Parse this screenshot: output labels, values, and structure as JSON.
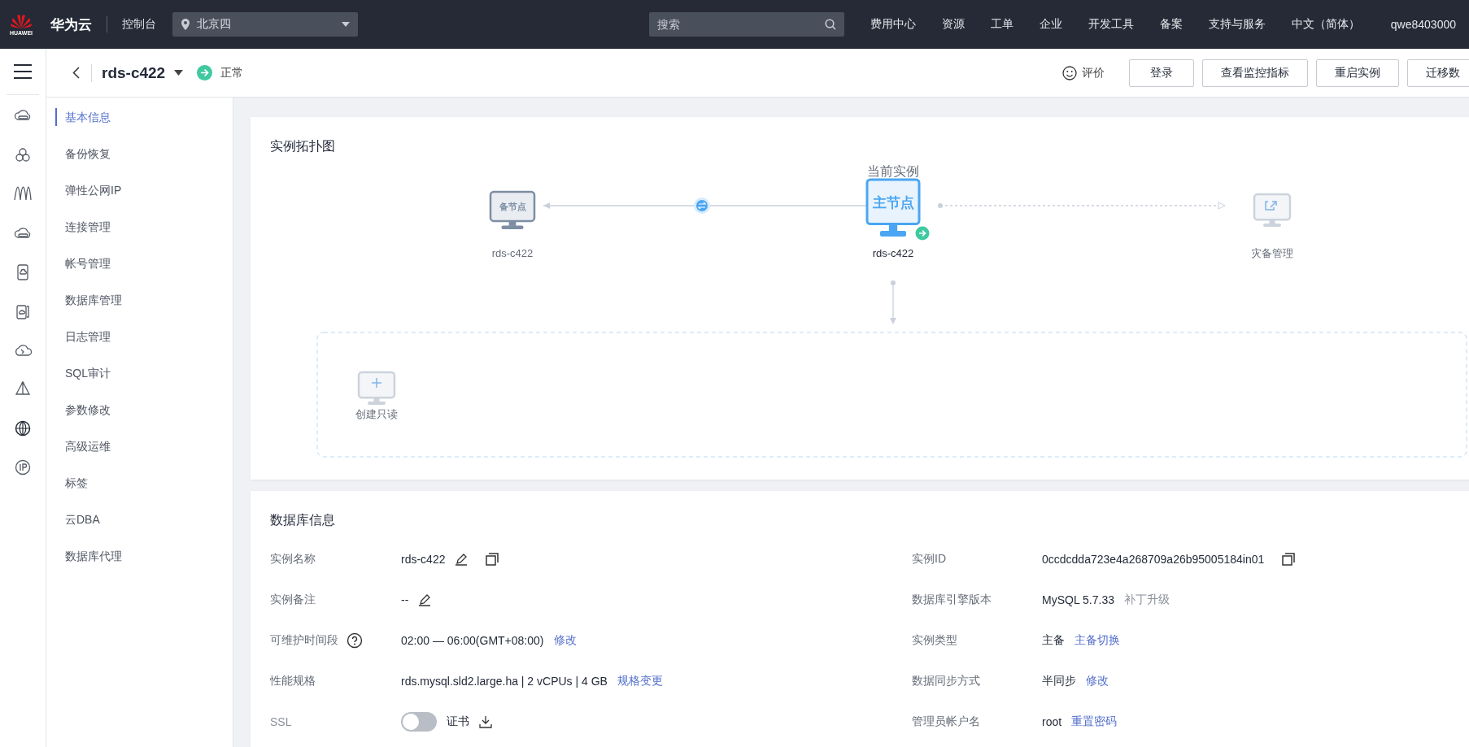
{
  "topbar": {
    "logo_text": "HUAWEI",
    "brand": "华为云",
    "console": "控制台",
    "region": "北京四",
    "search": {
      "placeholder": "搜索"
    },
    "nav": [
      "费用中心",
      "资源",
      "工单",
      "企业",
      "开发工具",
      "备案",
      "支持与服务",
      "中文（简体）"
    ],
    "user": "qwe8403000"
  },
  "header": {
    "title": "rds-c422",
    "status": "正常",
    "feedback": "评价",
    "buttons": [
      "登录",
      "查看监控指标",
      "重启实例",
      "迁移数"
    ]
  },
  "sidebar": {
    "items": [
      {
        "label": "基本信息",
        "selected": true
      },
      {
        "label": "备份恢复",
        "selected": false
      },
      {
        "label": "弹性公网IP",
        "selected": false
      },
      {
        "label": "连接管理",
        "selected": false
      },
      {
        "label": "帐号管理",
        "selected": false
      },
      {
        "label": "数据库管理",
        "selected": false
      },
      {
        "label": "日志管理",
        "selected": false
      },
      {
        "label": "SQL审计",
        "selected": false
      },
      {
        "label": "参数修改",
        "selected": false
      },
      {
        "label": "高级运维",
        "selected": false
      },
      {
        "label": "标签",
        "selected": false
      },
      {
        "label": "云DBA",
        "selected": false
      },
      {
        "label": "数据库代理",
        "selected": false
      }
    ]
  },
  "topology": {
    "title": "实例拓扑图",
    "current_label": "当前实例",
    "standby": {
      "badge": "备节点",
      "label": "rds-c422"
    },
    "primary": {
      "badge": "主节点",
      "label": "rds-c422"
    },
    "disaster": {
      "label": "灾备管理"
    },
    "readonly": {
      "label": "创建只读"
    }
  },
  "info": {
    "title": "数据库信息",
    "fields": [
      {
        "label": "实例名称",
        "parts": [
          {
            "kind": "text",
            "text": "rds-c422"
          },
          {
            "kind": "edit"
          },
          {
            "kind": "copy"
          }
        ]
      },
      {
        "label": "实例ID",
        "parts": [
          {
            "kind": "text",
            "text": "0ccdcdda723e4a268709a26b95005184in01"
          },
          {
            "kind": "copy"
          }
        ]
      },
      {
        "label": "实例备注",
        "parts": [
          {
            "kind": "text",
            "text": "--"
          },
          {
            "kind": "edit"
          }
        ]
      },
      {
        "label": "数据库引擎版本",
        "parts": [
          {
            "kind": "text",
            "text": "MySQL 5.7.33"
          },
          {
            "kind": "muted",
            "text": "补丁升级"
          }
        ]
      },
      {
        "label": "可维护时间段",
        "help": true,
        "parts": [
          {
            "kind": "text",
            "text": "02:00 — 06:00(GMT+08:00)"
          },
          {
            "kind": "link",
            "text": "修改"
          }
        ]
      },
      {
        "label": "实例类型",
        "parts": [
          {
            "kind": "text",
            "text": "主备"
          },
          {
            "kind": "link",
            "text": "主备切换"
          }
        ]
      },
      {
        "label": "性能规格",
        "parts": [
          {
            "kind": "text",
            "text": "rds.mysql.sld2.large.ha | 2 vCPUs | 4 GB"
          },
          {
            "kind": "link",
            "text": "规格变更"
          }
        ]
      },
      {
        "label": "数据同步方式",
        "parts": [
          {
            "kind": "text",
            "text": "半同步"
          },
          {
            "kind": "link",
            "text": "修改"
          }
        ]
      },
      {
        "label": "SSL",
        "parts": [
          {
            "kind": "switch",
            "on": false
          },
          {
            "kind": "text",
            "text": "证书"
          },
          {
            "kind": "download"
          }
        ]
      },
      {
        "label": "管理员帐户名",
        "parts": [
          {
            "kind": "text",
            "text": "root"
          },
          {
            "kind": "link",
            "text": "重置密码"
          }
        ]
      }
    ]
  }
}
